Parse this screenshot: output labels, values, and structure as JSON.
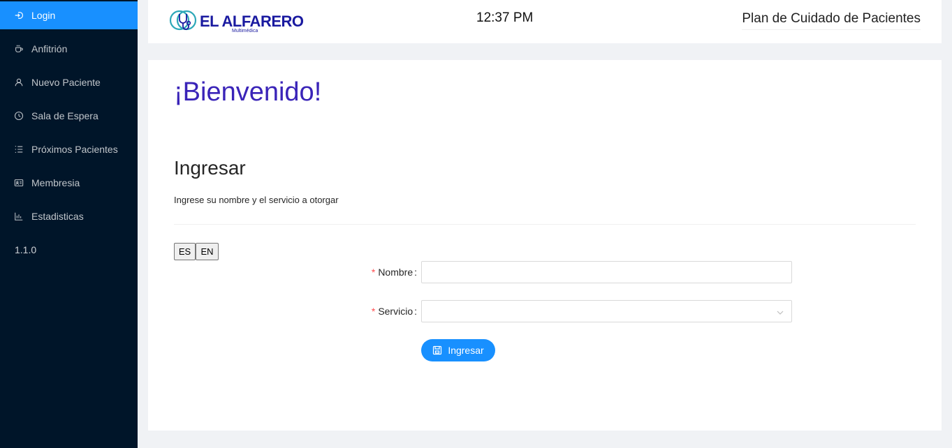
{
  "sidebar": {
    "items": [
      {
        "label": "Login",
        "icon": "login-icon"
      },
      {
        "label": "Anfitrión",
        "icon": "coffee-icon"
      },
      {
        "label": "Nuevo Paciente",
        "icon": "user-icon"
      },
      {
        "label": "Sala de Espera",
        "icon": "clock-icon"
      },
      {
        "label": "Próximos Pacientes",
        "icon": "ordered-list-icon"
      },
      {
        "label": "Membresia",
        "icon": "id-card-icon"
      },
      {
        "label": "Estadisticas",
        "icon": "bar-chart-icon"
      }
    ],
    "version": "1.1.0",
    "active_color": "#1890ff",
    "background": "#001529"
  },
  "header": {
    "logo_name": "EL ALFARERO",
    "logo_sub": "Multimédica",
    "clock": "12:37 PM",
    "app_title": "Plan de Cuidado de Pacientes"
  },
  "main": {
    "welcome": "¡Bienvenido!",
    "section_title": "Ingresar",
    "section_subtitle": "Ingrese su nombre y el servicio a otorgar",
    "lang_es": "ES",
    "lang_en": "EN",
    "form": {
      "nombre_label": "Nombre",
      "nombre_value": "",
      "servicio_label": "Servicio",
      "servicio_value": "",
      "required_mark": "*",
      "colon": ":",
      "submit_label": "Ingresar"
    }
  }
}
